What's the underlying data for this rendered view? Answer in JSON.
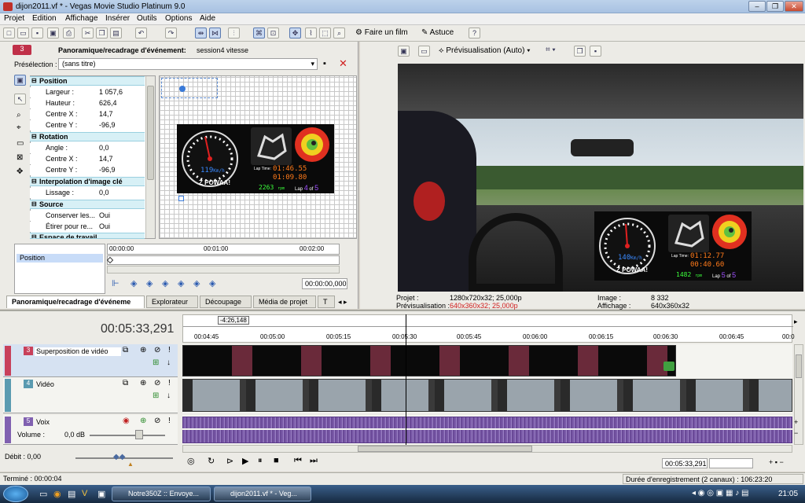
{
  "window": {
    "title": "dijon2011.vf * - Vegas Movie Studio Platinum 9.0"
  },
  "menu": [
    "Projet",
    "Edition",
    "Affichage",
    "Insérer",
    "Outils",
    "Options",
    "Aide"
  ],
  "toolbar": {
    "make_movie": "Faire un film",
    "tip": "Astuce"
  },
  "pan": {
    "track_num": "3",
    "title_prefix": "Panoramique/recadrage d'événement:",
    "title_event": "session4 vitesse",
    "preset_label": "Présélection :",
    "preset_value": "(sans titre)",
    "groups": {
      "position": "Position",
      "rotation": "Rotation",
      "interp": "Interpolation d'image clé",
      "source": "Source",
      "workspace": "Espace de travail"
    },
    "rows": {
      "largeur_k": "Largeur :",
      "largeur_v": "1 057,6",
      "hauteur_k": "Hauteur :",
      "hauteur_v": "626,4",
      "cx_k": "Centre X :",
      "cx_v": "14,7",
      "cy_k": "Centre Y :",
      "cy_v": "-96,9",
      "angle_k": "Angle :",
      "angle_v": "0,0",
      "rcx_k": "Centre X :",
      "rcx_v": "14,7",
      "rcy_k": "Centre Y :",
      "rcy_v": "-96,9",
      "lissage_k": "Lissage :",
      "lissage_v": "0,0",
      "conserver_k": "Conserver les...",
      "conserver_v": "Oui",
      "etirer_k": "Étirer pour re...",
      "etirer_v": "Oui"
    },
    "keyframe_track": "Position",
    "ruler": [
      "00:00:00",
      "00:01:00",
      "00:02:00"
    ],
    "timecode": "00:00:00,000",
    "tabs": [
      "Panoramique/recadrage d'événeme",
      "Explorateur",
      "Découpage",
      "Média de projet"
    ]
  },
  "overlay": {
    "speed": "119",
    "speed_unit": "Km/h",
    "slogan": "Z POWAA!",
    "lap_label": "Lap Time:",
    "lap_time": "01:46.55",
    "lap_delta": "01:09.80",
    "rpm": "2263",
    "rpm_unit": "rpm",
    "lap_word": "Lap",
    "lap_num": "4",
    "lap_of": "5"
  },
  "preview": {
    "mode": "Prévisualisation (Auto)",
    "projet_label": "Projet :",
    "projet_value": "1280x720x32; 25,000p",
    "prev_label": "Prévisualisation :",
    "prev_value": "640x360x32; 25,000p",
    "image_label": "Image :",
    "image_value": "8 332",
    "affichage_label": "Affichage :",
    "affichage_value": "640x360x32",
    "overlay_speed": "140",
    "overlay_lap_time": "01:12.77",
    "overlay_lap_delta": "00:40.60",
    "overlay_rpm": "1482",
    "overlay_lap_num": "5",
    "overlay_lap_of": "5"
  },
  "timeline": {
    "current_time": "00:05:33,291",
    "marker": "-4:26,148",
    "ruler": [
      "00:04:45",
      "00:05:00",
      "00:05:15",
      "00:05:30",
      "00:05:45",
      "00:06:00",
      "00:06:15",
      "00:06:30",
      "00:06:45",
      "00:0"
    ],
    "tracks": [
      {
        "num": "3",
        "name": "Superposition de vidéo",
        "color": "#c8405a"
      },
      {
        "num": "4",
        "name": "Vidéo",
        "color": "#5a9ab0"
      },
      {
        "num": "5",
        "name": "Voix",
        "color": "#8060b0"
      }
    ],
    "volume_label": "Volume :",
    "volume_value": "0,0 dB",
    "rate_label": "Débit : 0,00",
    "transport_time": "00:05:33,291"
  },
  "status": {
    "left": "Terminé : 00:00:04",
    "right": "Durée d'enregistrement (2 canaux) : 106:23:20"
  },
  "taskbar": {
    "btn1": "Notre350Z :: Envoye...",
    "btn2": "dijon2011.vf * - Veg...",
    "clock": "21:05"
  },
  "colors": {
    "accent": "#3a6ea5",
    "overlay_bg": "#0a0a0a",
    "lcd_orange": "#ff7a1a",
    "lcd_green": "#3cff3c",
    "audio": "#7a5aa8"
  }
}
